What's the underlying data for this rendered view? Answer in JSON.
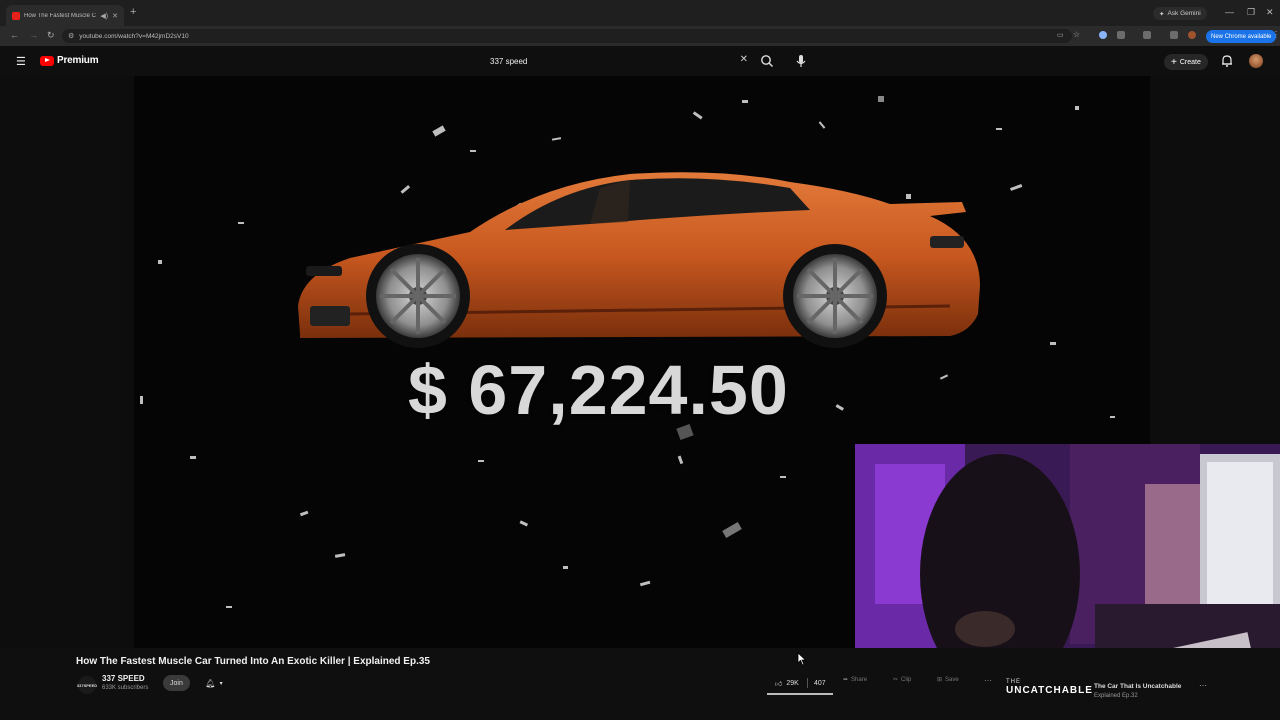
{
  "browser": {
    "tab_title": "How The Fastest Muscle Ca",
    "new_tab": "+",
    "gemini_label": "Ask Gemini",
    "url": "youtube.com/watch?v=M42jmD2sV10",
    "update_label": "New Chrome available"
  },
  "youtube": {
    "logo_text": "Premium",
    "search_value": "337 speed",
    "create_label": "Create"
  },
  "video": {
    "price_overlay": "$ 67,224.50",
    "car_color": "#c8581f"
  },
  "info": {
    "title": "How The Fastest Muscle Car Turned Into An Exotic Killer | Explained Ep.35",
    "channel_name": "337 SPEED",
    "channel_avatar_text": "337SPEED",
    "subscribers": "633K subscribers",
    "join_label": "Join",
    "likes": "29K",
    "dislikes": "407",
    "share_label": "Share",
    "download_label": "Clip",
    "save_label": "Save"
  },
  "recommendation": {
    "brand_line1": "THE",
    "brand_line2": "UNCATCHABLE",
    "title": "The Car That Is Uncatchable",
    "subtitle": "Explained Ep.32"
  },
  "colors": {
    "youtube_red": "#ff0000",
    "update_blue": "#1a73e8",
    "webcam_purple": "#8a3ad0"
  }
}
